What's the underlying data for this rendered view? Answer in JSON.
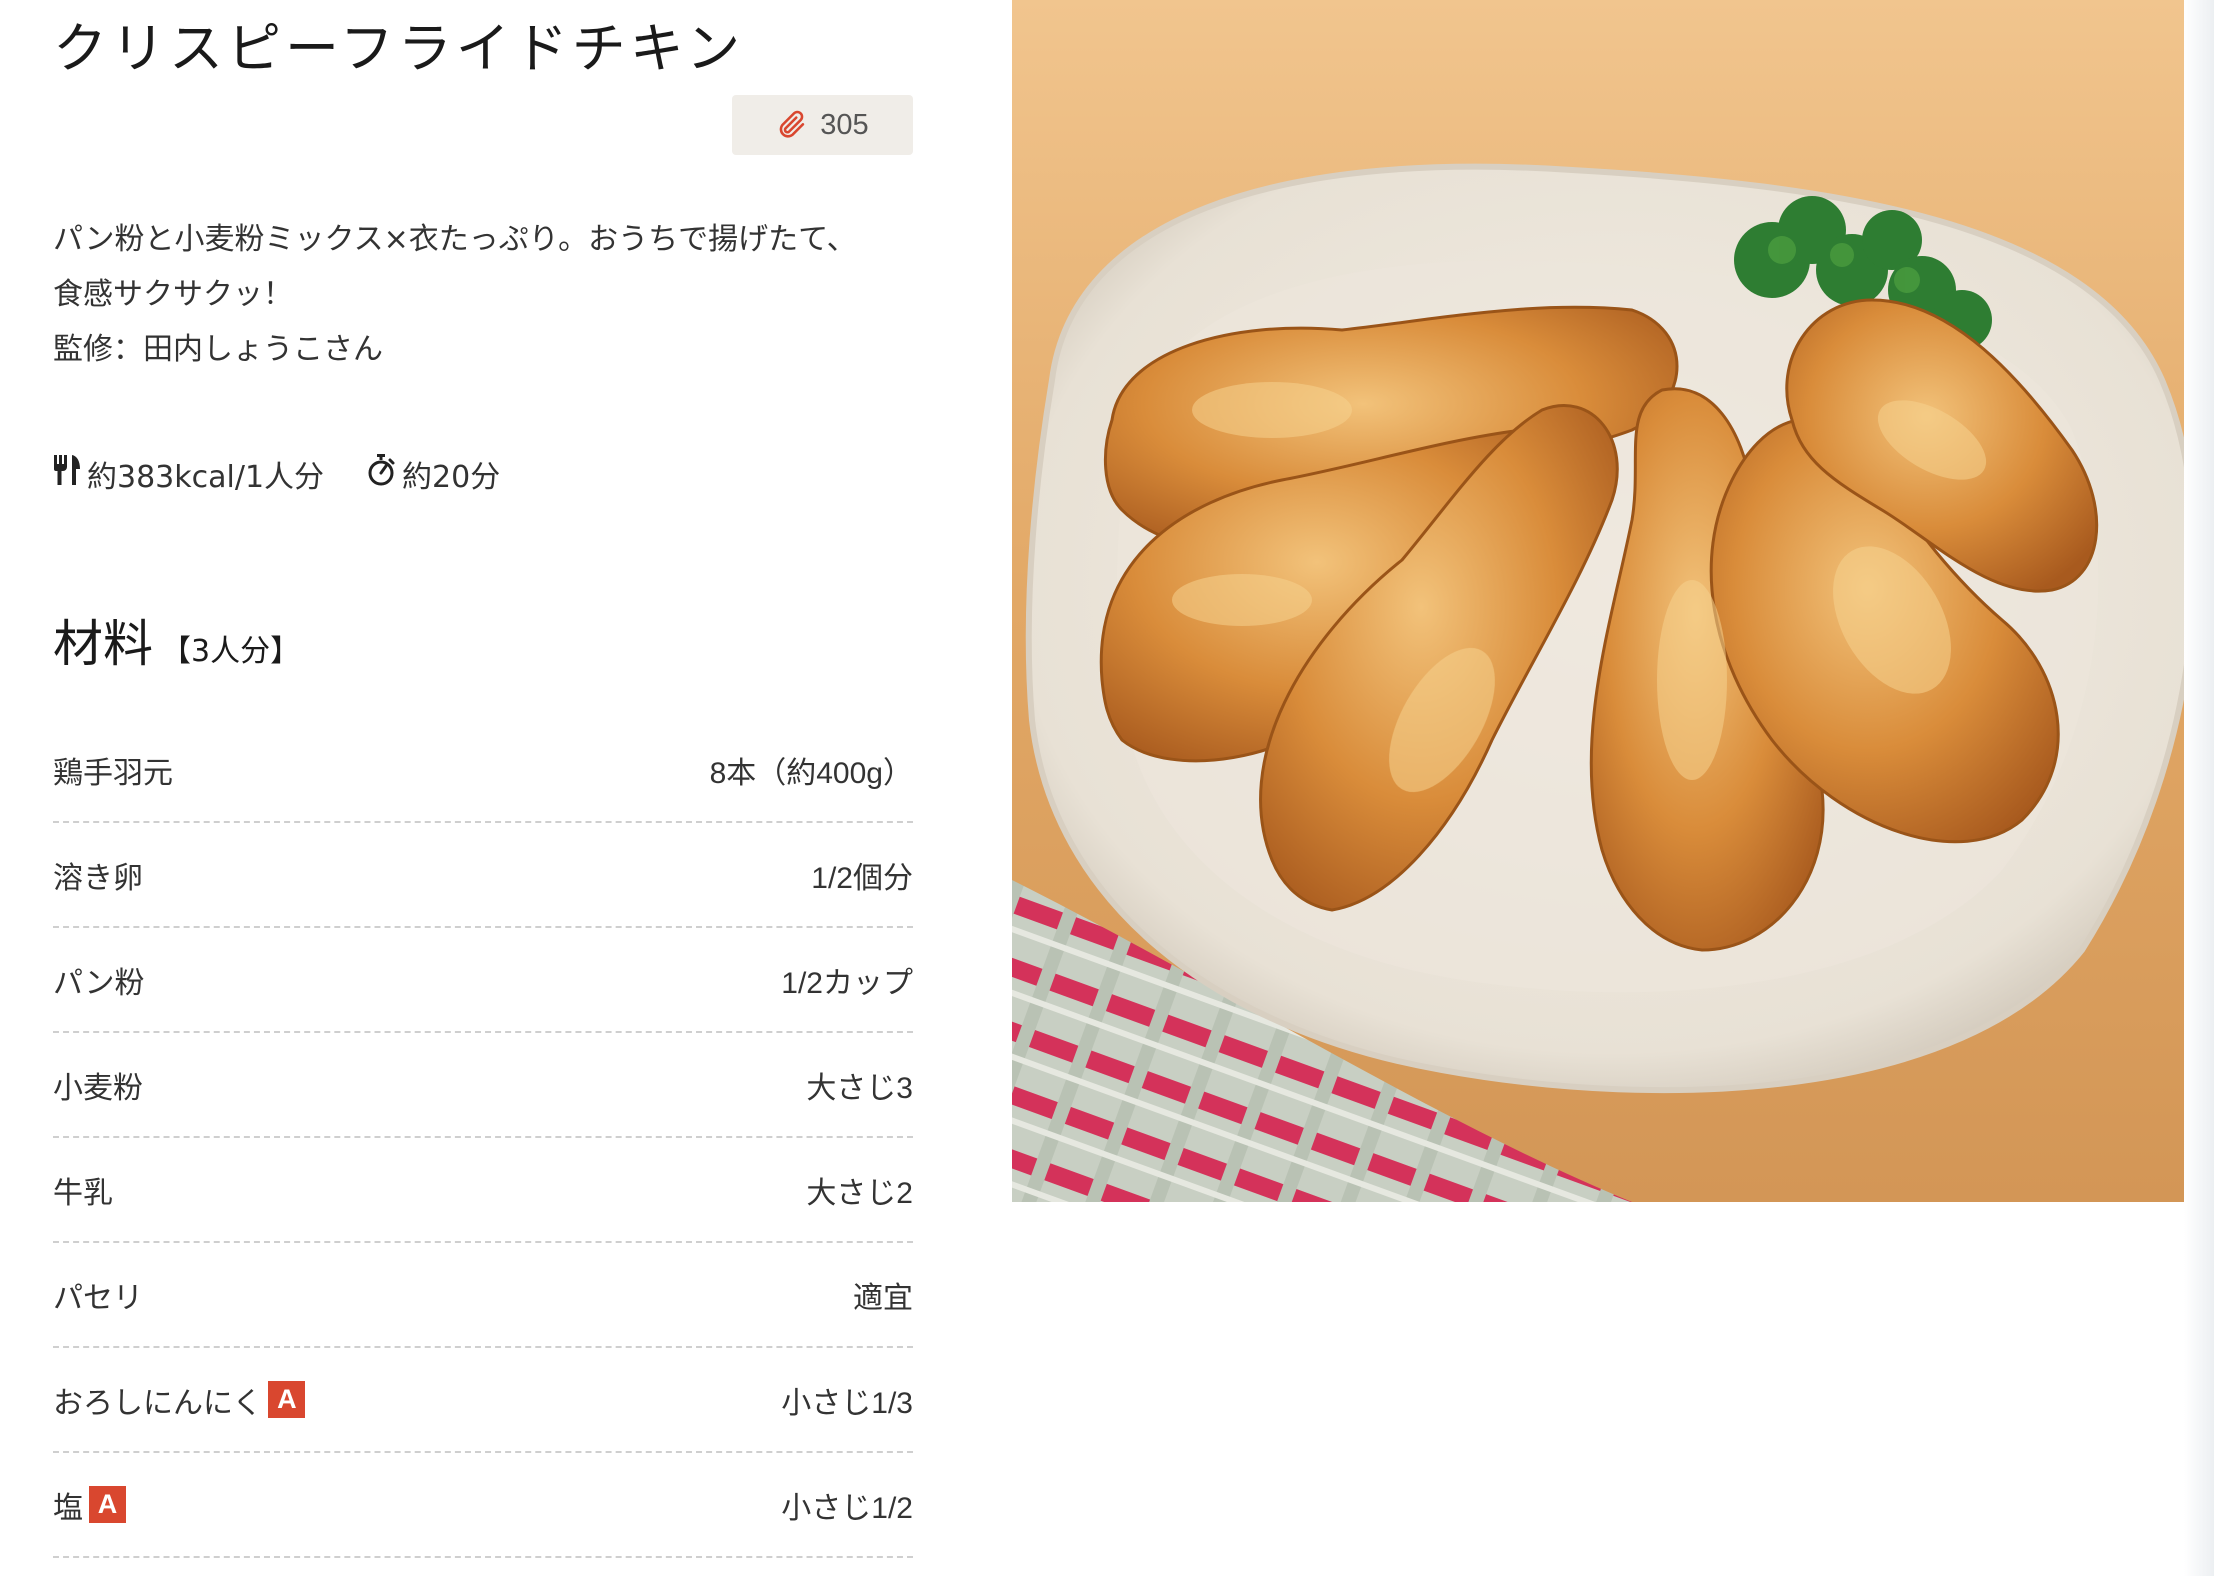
{
  "recipe": {
    "title": "クリスピーフライドチキン",
    "clip_count": "305",
    "clip_icon": "paperclip-icon",
    "description_lines": [
      "パン粉と小麦粉ミックス×衣たっぷり。おうちで揚げたて、",
      "食感サクサクッ！",
      "監修：田内しょうこさん"
    ],
    "calories": "約383kcal/1人分",
    "calories_icon": "fork-knife-icon",
    "time": "約20分",
    "time_icon": "stopwatch-icon"
  },
  "ingredients_section": {
    "title": "材料",
    "servings": "【3人分】",
    "badge_color": "#d9472f",
    "items": [
      {
        "name": "鶏手羽元",
        "amount": "8本（約400g）",
        "group": ""
      },
      {
        "name": "溶き卵",
        "amount": "1/2個分",
        "group": ""
      },
      {
        "name": "パン粉",
        "amount": "1/2カップ",
        "group": ""
      },
      {
        "name": "小麦粉",
        "amount": "大さじ3",
        "group": ""
      },
      {
        "name": "牛乳",
        "amount": "大さじ2",
        "group": ""
      },
      {
        "name": "パセリ",
        "amount": "適宜",
        "group": ""
      },
      {
        "name": "おろしにんにく",
        "amount": "小さじ1/3",
        "group": "A"
      },
      {
        "name": "塩",
        "amount": "小さじ1/2",
        "group": "A"
      }
    ]
  }
}
